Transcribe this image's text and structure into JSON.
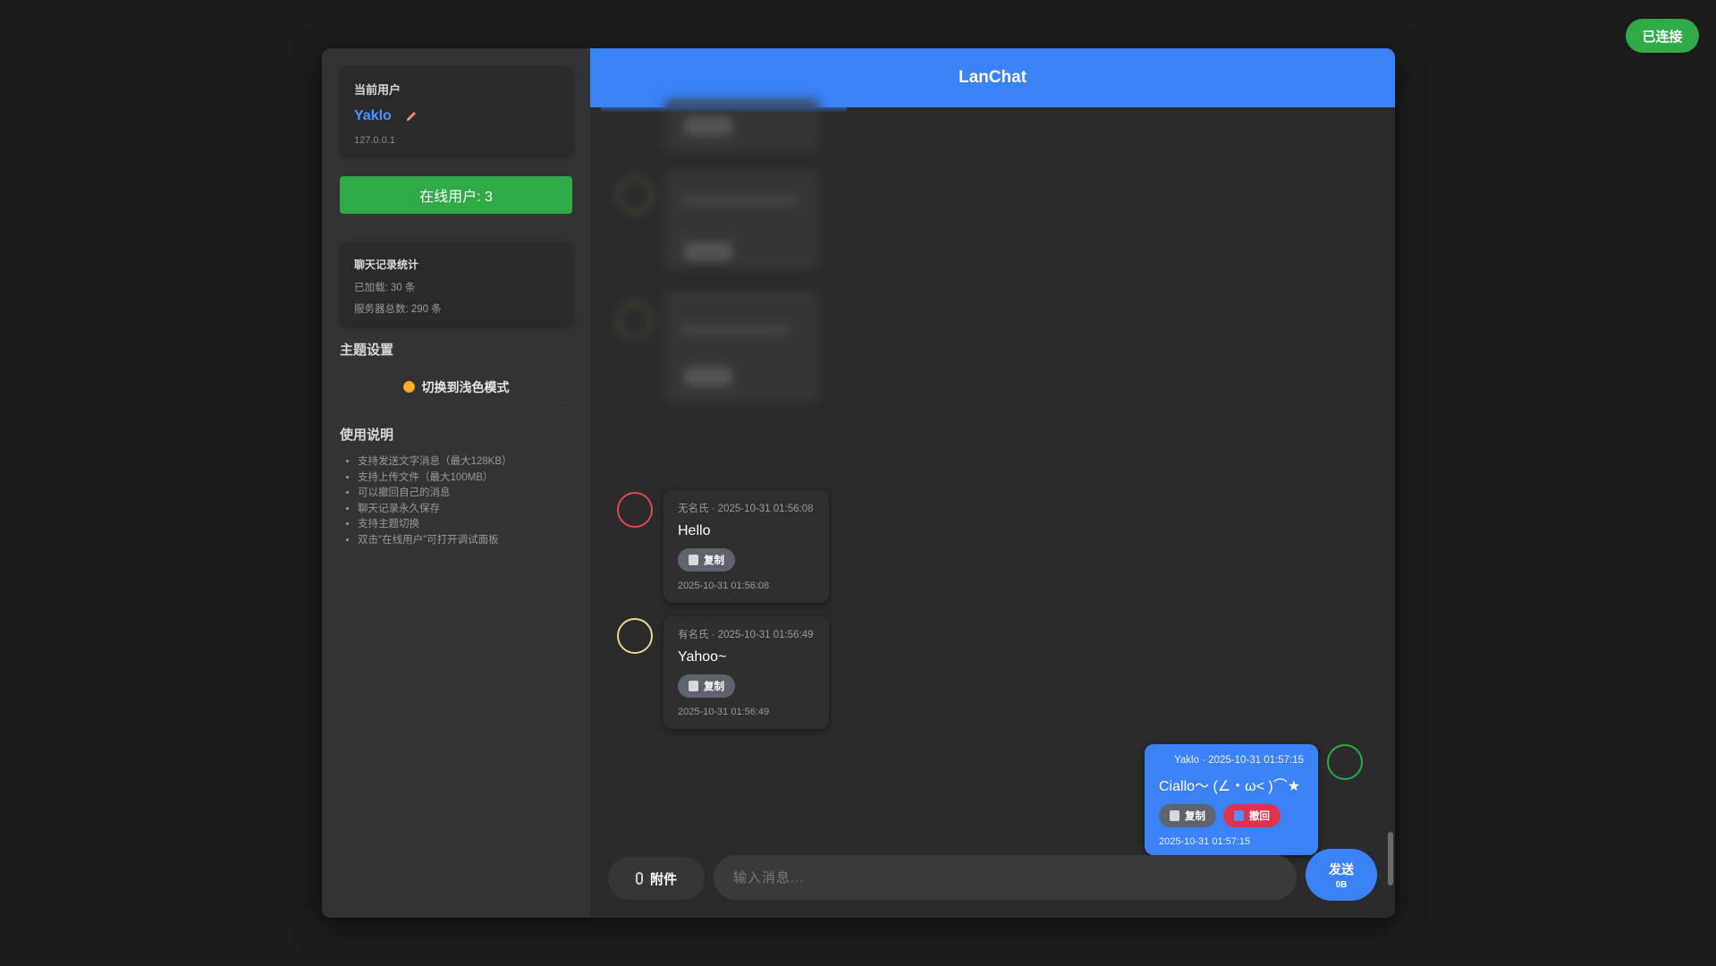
{
  "connection_status": "已连接",
  "sidebar": {
    "current_user_title": "当前用户",
    "user_name": "Yaklo",
    "user_ip": "127.0.0.1",
    "online_users": "在线用户: 3",
    "stats": {
      "title": "聊天记录统计",
      "loaded": "已加载: 30 条",
      "server_total": "服务器总数: 290 条"
    },
    "theme": {
      "title": "主题设置",
      "toggle_label": "切换到浅色模式"
    },
    "help": {
      "title": "使用说明",
      "items": [
        "支持发送文字消息（最大128KB）",
        "支持上传文件（最大100MB）",
        "可以撤回自己的消息",
        "聊天记录永久保存",
        "支持主题切换",
        "双击\"在线用户\"可打开调试面板"
      ]
    }
  },
  "header": {
    "title": "LanChat"
  },
  "messages": [
    {
      "meta": "无名氏 · 2025-10-31 01:56:08",
      "text": "Hello",
      "copy_label": "复制",
      "time": "2025-10-31 01:56:08",
      "avatar_color": "#e0484d"
    },
    {
      "meta": "有名氏 · 2025-10-31 01:56:49",
      "text": "Yahoo~",
      "copy_label": "复制",
      "time": "2025-10-31 01:56:49",
      "avatar_color": "#e8d890"
    },
    {
      "meta": "Yaklo · 2025-10-31 01:57:15",
      "text": "Ciallo～ (∠・ω< )⌒★",
      "copy_label": "复制",
      "recall_label": "撤回",
      "time": "2025-10-31 01:57:15",
      "avatar_color": "#2faa46"
    }
  ],
  "composer": {
    "attach_label": "附件",
    "placeholder": "输入消息...",
    "send_label": "发送",
    "send_size": "0B"
  },
  "colors": {
    "accent": "#3b82f6",
    "success": "#2faa46",
    "danger": "#e0324f"
  }
}
